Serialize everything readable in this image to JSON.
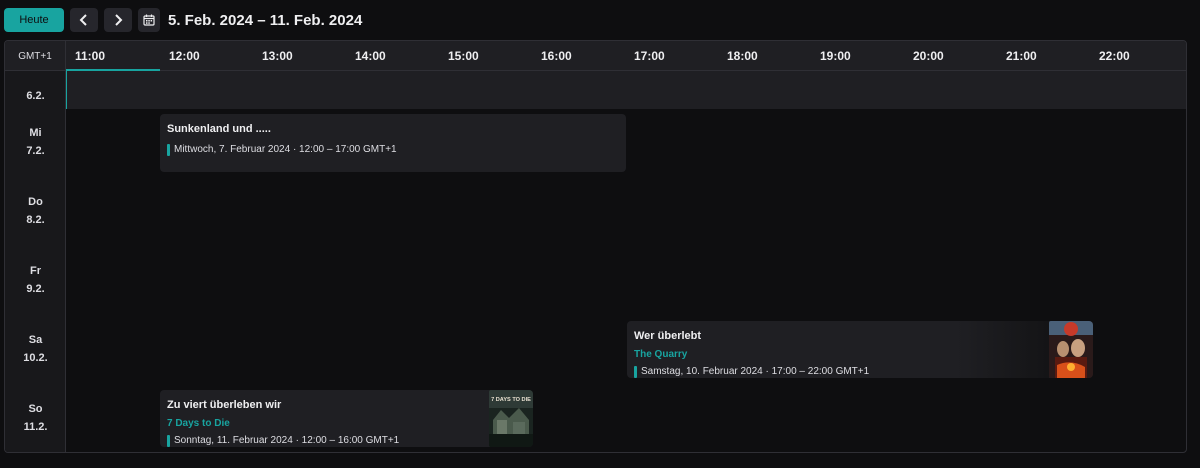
{
  "toolbar": {
    "today_label": "Heute",
    "prev_icon": "chevron-left-icon",
    "next_icon": "chevron-right-icon",
    "calendar_icon": "calendar-icon",
    "range": "5. Feb. 2024 – 11. Feb. 2024"
  },
  "calendar": {
    "timezone": "GMT+1",
    "hours": [
      "11:00",
      "12:00",
      "13:00",
      "14:00",
      "15:00",
      "16:00",
      "17:00",
      "18:00",
      "19:00",
      "20:00",
      "21:00",
      "22:00"
    ],
    "current_hour": "11:00",
    "days": [
      {
        "weekday": "",
        "date": "6.2."
      },
      {
        "weekday": "Mi",
        "date": "7.2."
      },
      {
        "weekday": "Do",
        "date": "8.2."
      },
      {
        "weekday": "Fr",
        "date": "9.2."
      },
      {
        "weekday": "Sa",
        "date": "10.2."
      },
      {
        "weekday": "So",
        "date": "11.2."
      }
    ]
  },
  "events": [
    {
      "title": "Sunkenland und .....",
      "game": "",
      "time": "Mittwoch, 7. Februar 2024 · 12:00 – 17:00 GMT+1",
      "cover": ""
    },
    {
      "title": "Wer überlebt",
      "game": "The Quarry",
      "time": "Samstag, 10. Februar 2024 · 17:00 – 22:00 GMT+1",
      "cover": "the-quarry-cover"
    },
    {
      "title": "Zu viert überleben wir",
      "game": "7 Days to Die",
      "time": "Sonntag, 11. Februar 2024 · 12:00 – 16:00 GMT+1",
      "cover": "7-days-to-die-cover",
      "cover_text": "7 DAYS TO DIE"
    }
  ],
  "colors": {
    "accent": "#18a4a0",
    "background": "#0e0e10",
    "surface": "#1f1f23",
    "event_card": "#1f1f23"
  }
}
